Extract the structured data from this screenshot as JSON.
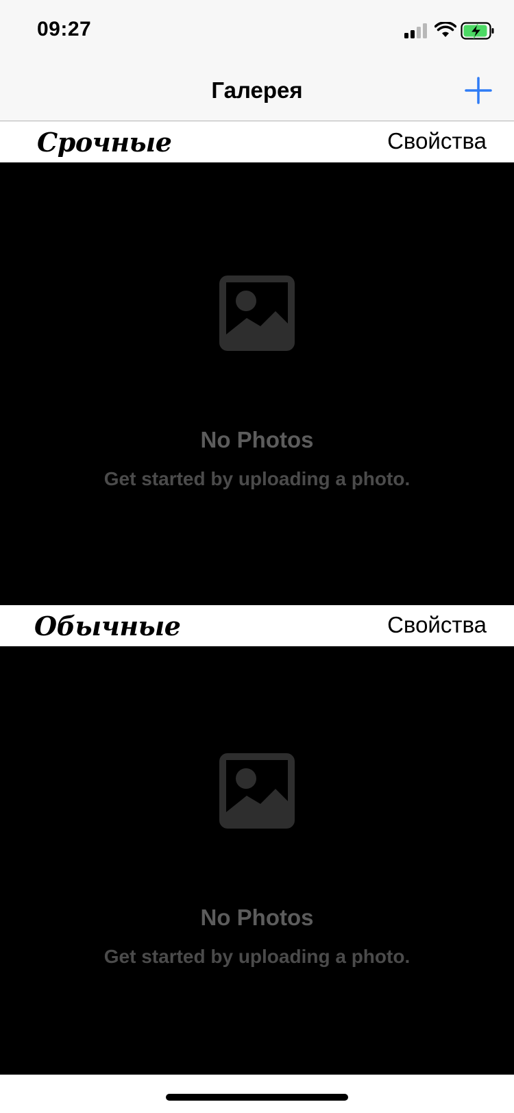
{
  "status_bar": {
    "time": "09:27"
  },
  "nav": {
    "title": "Галерея",
    "add_icon": "plus-icon"
  },
  "sections": [
    {
      "title": "Срочные",
      "action_label": "Свойства",
      "empty_title": "No Photos",
      "empty_subtitle": "Get started by uploading a photo.",
      "icon": "photo-placeholder-icon"
    },
    {
      "title": "Обычные",
      "action_label": "Свойства",
      "empty_title": "No Photos",
      "empty_subtitle": "Get started by uploading a photo.",
      "icon": "photo-placeholder-icon"
    }
  ],
  "colors": {
    "accent": "#2f7cf6",
    "battery_fill": "#4cd964"
  }
}
